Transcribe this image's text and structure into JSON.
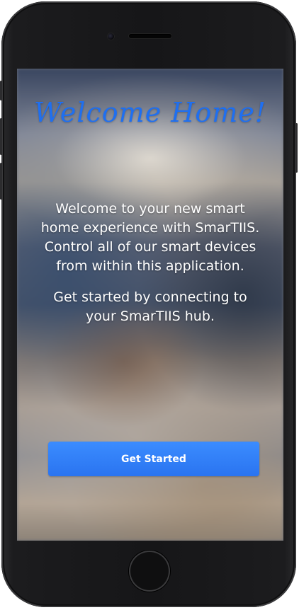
{
  "welcome": {
    "title": "Welcome  Home!",
    "paragraph_1": "Welcome to your new smart home experience with SmarTIIS. Control all of our smart devices from within this application.",
    "paragraph_2": "Get started by connecting to your SmarTIIS hub."
  },
  "actions": {
    "get_started_label": "Get Started"
  },
  "colors": {
    "title": "#1f6ff0",
    "button": "#2a74f0",
    "device_frame": "#161618"
  },
  "icons": {
    "front_camera": "camera-icon",
    "speaker": "speaker-icon",
    "home_button": "home-button-icon"
  }
}
